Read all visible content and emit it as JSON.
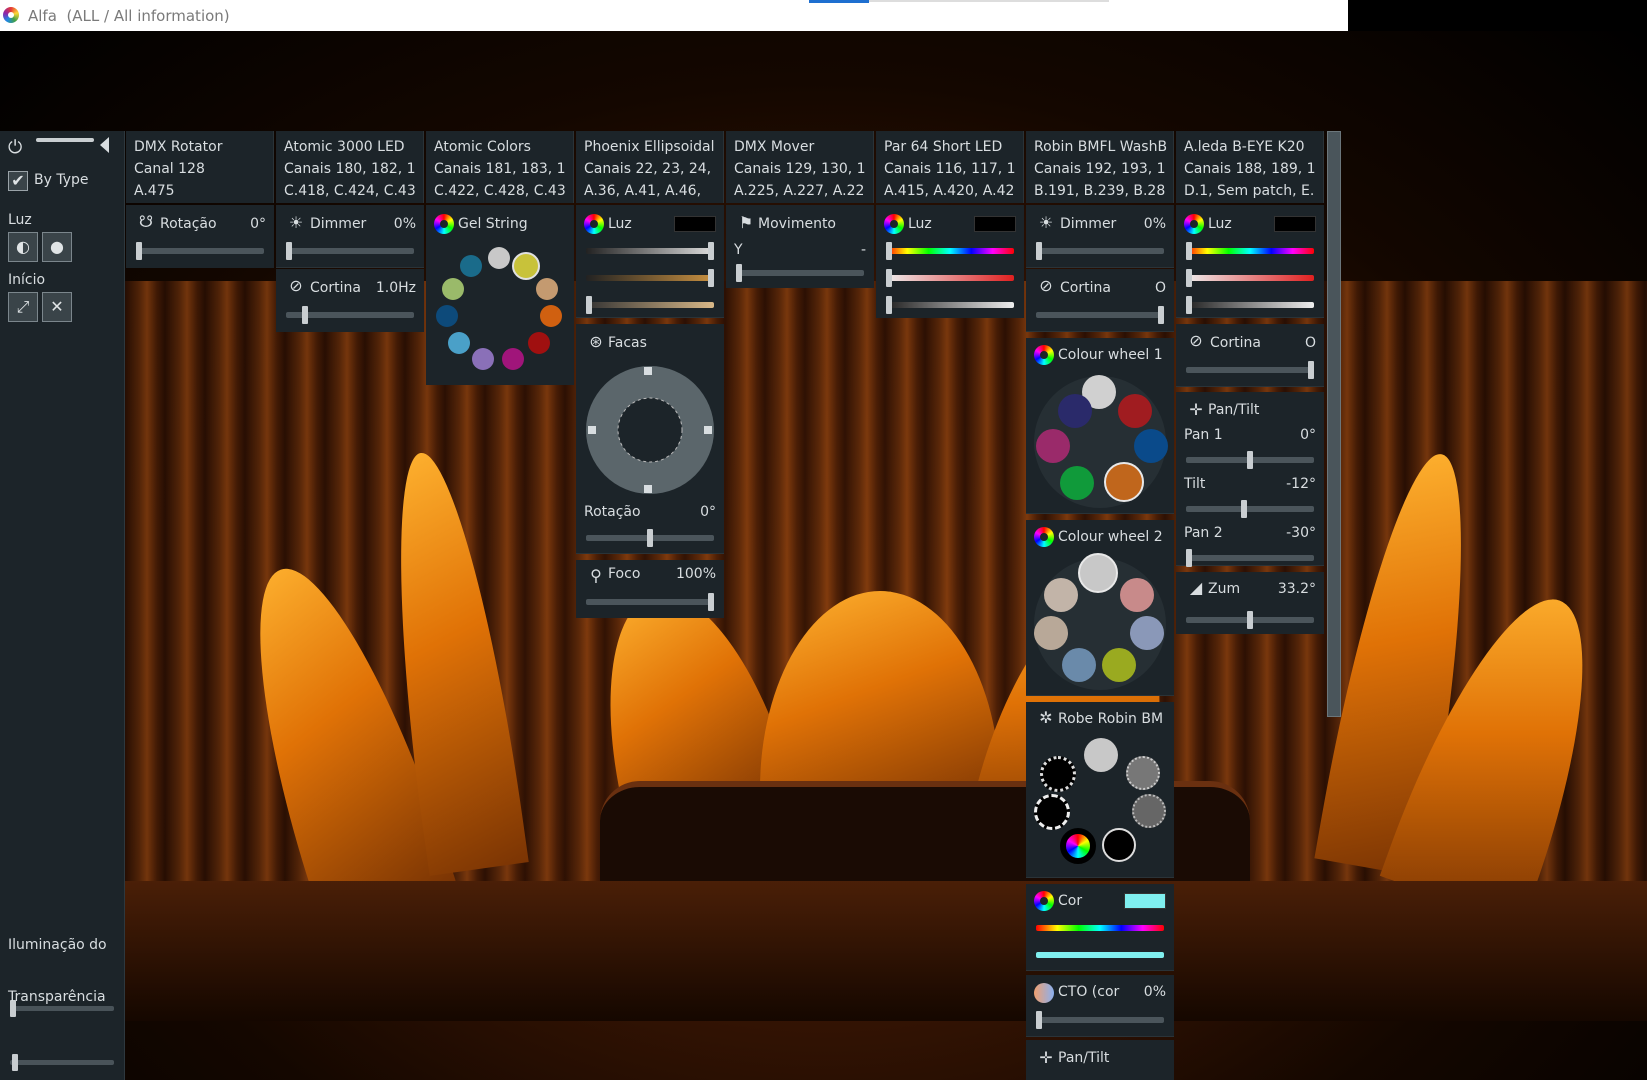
{
  "window": {
    "title": "Alfa  (ALL / All information)"
  },
  "sidebar": {
    "by_type_label": "By Type",
    "luz_label": "Luz",
    "inicio_label": "Início",
    "iluminacao_label": "Iluminação do",
    "transparencia_label": "Transparência"
  },
  "fixtures": [
    {
      "name": "DMX Rotator",
      "channels": "Canal 128",
      "address": "A.475"
    },
    {
      "name": "Atomic 3000 LED",
      "channels": "Canais 180, 182, 1",
      "address": "C.418, C.424, C.43"
    },
    {
      "name": "Atomic Colors",
      "channels": "Canais 181, 183, 1",
      "address": "C.422, C.428, C.43"
    },
    {
      "name": "Phoenix Ellipsoidal",
      "channels": "Canais 22, 23, 24,",
      "address": "A.36, A.41, A.46,"
    },
    {
      "name": "DMX Mover",
      "channels": "Canais 129, 130, 1",
      "address": "A.225, A.227, A.22"
    },
    {
      "name": "Par 64 Short LED",
      "channels": "Canais 116, 117, 1",
      "address": "A.415, A.420, A.42"
    },
    {
      "name": "Robin BMFL WashB",
      "channels": "Canais 192, 193, 1",
      "address": "B.191, B.239, B.28"
    },
    {
      "name": "A.leda B-EYE K20",
      "channels": "Canais 188, 189, 1",
      "address": "D.1, Sem patch, E."
    }
  ],
  "controls": {
    "rotator": {
      "label": "Rotação",
      "value": "0°",
      "level": 0
    },
    "atomic_dimmer": {
      "label": "Dimmer",
      "value": "0%",
      "level": 0
    },
    "atomic_cortina": {
      "label": "Cortina",
      "value": "1.0Hz"
    },
    "gel": {
      "label": "Gel String"
    },
    "phoenix_luz": {
      "label": "Luz"
    },
    "phoenix_facas": {
      "label": "Facas"
    },
    "phoenix_rotacao": {
      "label": "Rotação",
      "value": "0°"
    },
    "phoenix_foco": {
      "label": "Foco",
      "value": "100%"
    },
    "mover_movimento": {
      "label": "Movimento",
      "axis": "Y",
      "axis_value": "-"
    },
    "par_luz": {
      "label": "Luz"
    },
    "robin_dimmer": {
      "label": "Dimmer",
      "value": "0%"
    },
    "robin_cortina": {
      "label": "Cortina",
      "value": "O"
    },
    "robin_cw1": {
      "label": "Colour wheel 1"
    },
    "robin_cw2": {
      "label": "Colour wheel 2"
    },
    "robin_gobo": {
      "label": "Robe Robin BM"
    },
    "robin_cor": {
      "label": "Cor",
      "swatch": "#7fefef"
    },
    "robin_cto": {
      "label": "CTO (cor",
      "value": "0%"
    },
    "robin_pantilt": {
      "label": "Pan/Tilt"
    },
    "beye_luz": {
      "label": "Luz"
    },
    "beye_cortina": {
      "label": "Cortina",
      "value": "O"
    },
    "beye_pantilt": {
      "label": "Pan/Tilt"
    },
    "beye_pan1": {
      "label": "Pan 1",
      "value": "0°"
    },
    "beye_tilt": {
      "label": "Tilt",
      "value": "-12°"
    },
    "beye_pan2": {
      "label": "Pan 2",
      "value": "-30°"
    },
    "beye_zum": {
      "label": "Zum",
      "value": "33.2°"
    }
  },
  "colors": {
    "panel_bg": "#1c2429",
    "gel_selected": "#c8c23a",
    "cw1_selected": "#c0661c"
  }
}
